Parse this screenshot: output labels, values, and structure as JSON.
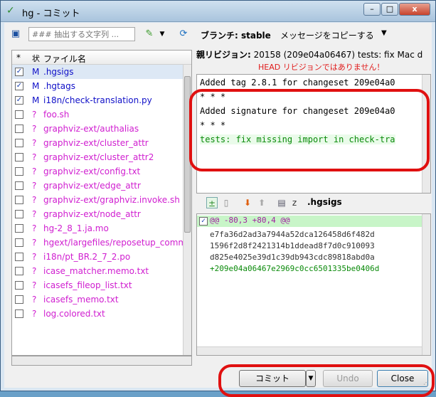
{
  "window": {
    "title": "hg - コミット",
    "controls": {
      "minimize": "–",
      "maximize": "□",
      "close": "x"
    }
  },
  "toolbar": {
    "filter_placeholder": "### 抽出する文字列 ...",
    "branch_label": "ブランチ: stable",
    "copy_message_label": "メッセージをコピーする",
    "icons": [
      "checkbox-toggle-icon",
      "filter-icon",
      "status-help-icon",
      "refresh-icon",
      "chevron-down-icon"
    ]
  },
  "filelist": {
    "columns": [
      "*",
      "状",
      "ファイル名"
    ],
    "files": [
      {
        "checked": true,
        "status": "M",
        "name": ".hgsigs",
        "kind": "m",
        "selected": true
      },
      {
        "checked": true,
        "status": "M",
        "name": ".hgtags",
        "kind": "m"
      },
      {
        "checked": true,
        "status": "M",
        "name": "i18n/check-translation.py",
        "kind": "m"
      },
      {
        "checked": false,
        "status": "?",
        "name": "foo.sh",
        "kind": "q"
      },
      {
        "checked": false,
        "status": "?",
        "name": "graphviz-ext/authalias",
        "kind": "q"
      },
      {
        "checked": false,
        "status": "?",
        "name": "graphviz-ext/cluster_attr",
        "kind": "q"
      },
      {
        "checked": false,
        "status": "?",
        "name": "graphviz-ext/cluster_attr2",
        "kind": "q"
      },
      {
        "checked": false,
        "status": "?",
        "name": "graphviz-ext/config.txt",
        "kind": "q"
      },
      {
        "checked": false,
        "status": "?",
        "name": "graphviz-ext/edge_attr",
        "kind": "q"
      },
      {
        "checked": false,
        "status": "?",
        "name": "graphviz-ext/graphviz.invoke.sh",
        "kind": "q"
      },
      {
        "checked": false,
        "status": "?",
        "name": "graphviz-ext/node_attr",
        "kind": "q"
      },
      {
        "checked": false,
        "status": "?",
        "name": "hg-2_8_1.ja.mo",
        "kind": "q"
      },
      {
        "checked": false,
        "status": "?",
        "name": "hgext/largefiles/reposetup_comm",
        "kind": "q"
      },
      {
        "checked": false,
        "status": "?",
        "name": "i18n/pt_BR.2_7_2.po",
        "kind": "q"
      },
      {
        "checked": false,
        "status": "?",
        "name": "icase_matcher.memo.txt",
        "kind": "q"
      },
      {
        "checked": false,
        "status": "?",
        "name": "icasefs_fileop_list.txt",
        "kind": "q"
      },
      {
        "checked": false,
        "status": "?",
        "name": "icasefs_memo.txt",
        "kind": "q"
      },
      {
        "checked": false,
        "status": "?",
        "name": "log.colored.txt",
        "kind": "q"
      }
    ]
  },
  "commit": {
    "parent_label": "親リビジョン:",
    "parent_value": "20158 (209e04a06467) tests: fix Mac d",
    "warning": "HEAD リビジョンではありません！",
    "message_lines": [
      {
        "text": "Added tag 2.8.1 for changeset 209e04a0",
        "green": false
      },
      {
        "text": "* * *",
        "green": false
      },
      {
        "text": "Added signature for changeset 209e04a0",
        "green": false
      },
      {
        "text": "* * *",
        "green": false
      },
      {
        "text": "tests: fix missing import in check-tra",
        "green": true
      }
    ]
  },
  "diff": {
    "filename": ".hgsigs",
    "hunk_header": "@@ -80,3 +80,4 @@",
    "lines": [
      {
        "text": "e7fa36d2ad3a7944a52dca126458d6f482d",
        "add": false
      },
      {
        "text": "1596f2d8f2421314b1ddead8f7d0c910093",
        "add": false
      },
      {
        "text": "d825e4025e39d1c39db943cdc89818abd0a",
        "add": false
      },
      {
        "text": "+209e04a06467e2969c0cc6501335be0406d",
        "add": true
      }
    ]
  },
  "buttons": {
    "commit": "コミット",
    "commit_dropdown": "▼",
    "undo": "Undo",
    "close": "Close"
  },
  "colors": {
    "modified": "#1010c8",
    "unknown": "#d01ed0",
    "annotation": "#e01010",
    "hunk_bg": "#c8f5c8"
  }
}
